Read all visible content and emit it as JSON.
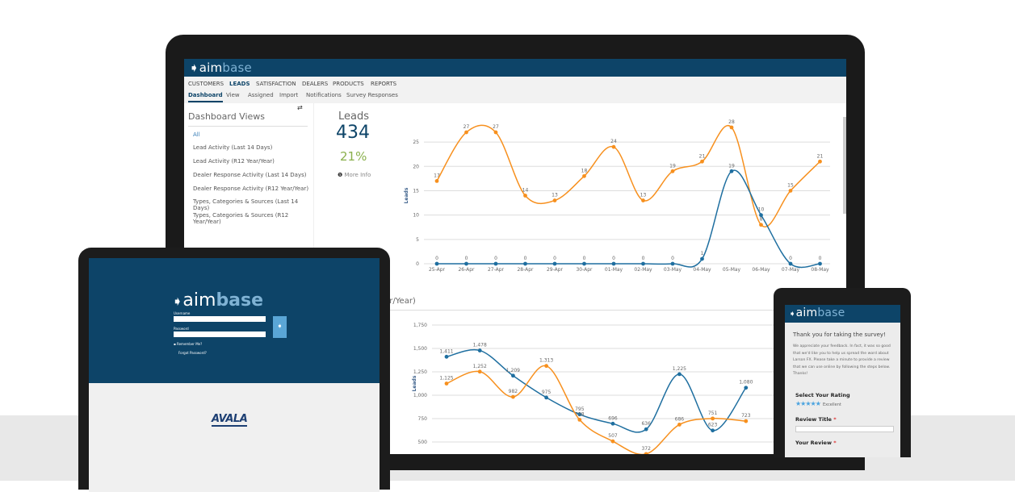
{
  "app": {
    "logo_a": "aim",
    "logo_b": "base"
  },
  "nav": {
    "primary": [
      "CUSTOMERS",
      "LEADS",
      "SATISFACTION",
      "DEALERS",
      "PRODUCTS",
      "REPORTS"
    ],
    "active_primary": "LEADS",
    "secondary": [
      "Dashboard",
      "View",
      "Assigned",
      "Import",
      "Notifications",
      "Survey Responses"
    ],
    "active_secondary": "Dashboard"
  },
  "sidebar": {
    "title": "Dashboard Views",
    "items": [
      "All",
      "Lead Activity (Last 14 Days)",
      "Lead Activity (R12 Year/Year)",
      "Dealer Response Activity (Last 14 Days)",
      "Dealer Response Activity (R12 Year/Year)",
      "Types, Categories & Sources (Last 14 Days)",
      "Types, Categories & Sources (R12 Year/Year)"
    ]
  },
  "stats": {
    "label": "Leads",
    "value": "434",
    "percent": "21%",
    "more_info": "More Info"
  },
  "second_section_title": "ear/Year)",
  "colors": {
    "brand": "#0d4468",
    "orange": "#f7901e",
    "blue": "#1f6fa0",
    "green": "#8ab04c",
    "star": "#4aa3df"
  },
  "chart_data": [
    {
      "type": "line",
      "ylabel": "Leads",
      "ylim": [
        0,
        28
      ],
      "yticks": [
        0,
        5,
        10,
        15,
        20,
        25
      ],
      "grid": true,
      "categories": [
        "25-Apr",
        "26-Apr",
        "27-Apr",
        "28-Apr",
        "29-Apr",
        "30-Apr",
        "01-May",
        "02-May",
        "03-May",
        "04-May",
        "05-May",
        "06-May",
        "07-May",
        "08-May"
      ],
      "series": [
        {
          "color": "#f7901e",
          "values": [
            17,
            27,
            27,
            14,
            13,
            18,
            24,
            13,
            19,
            21,
            28,
            8,
            15,
            21
          ]
        },
        {
          "color": "#1f6fa0",
          "values": [
            0,
            0,
            0,
            0,
            0,
            0,
            0,
            0,
            0,
            1,
            19,
            10,
            0,
            0
          ]
        }
      ]
    },
    {
      "type": "line",
      "ylabel": "Leads",
      "ylim": [
        500,
        1750
      ],
      "yticks": [
        "500",
        "750",
        "1,000",
        "1,250",
        "1,500",
        "1,750"
      ],
      "grid": true,
      "series": [
        {
          "color": "#1f6fa0",
          "values": [
            1411,
            1478,
            1209,
            975,
            795,
            696,
            636,
            1225,
            623,
            1080
          ]
        },
        {
          "color": "#f7901e",
          "values": [
            1125,
            1252,
            982,
            1313,
            738,
            507,
            372,
            686,
            751,
            723
          ]
        }
      ]
    }
  ],
  "login": {
    "username_label": "Username",
    "password_label": "Password",
    "remember": "Remember Me?",
    "forgot": "Forgot Password?",
    "partner_logo": "AVALA"
  },
  "survey": {
    "title": "Thank you for taking the survey!",
    "body": "We appreciate your feedback. In fact, it was so good that we'd like you to help us spread the word about Larson FX. Please take a minute to provide a review that we can use online by following the steps below. Thanks!",
    "rating_label": "Select Your Rating",
    "rating": 5,
    "rating_text": "Excellent",
    "review_title_label": "Review Title",
    "your_review_label": "Your Review",
    "required": "*"
  }
}
